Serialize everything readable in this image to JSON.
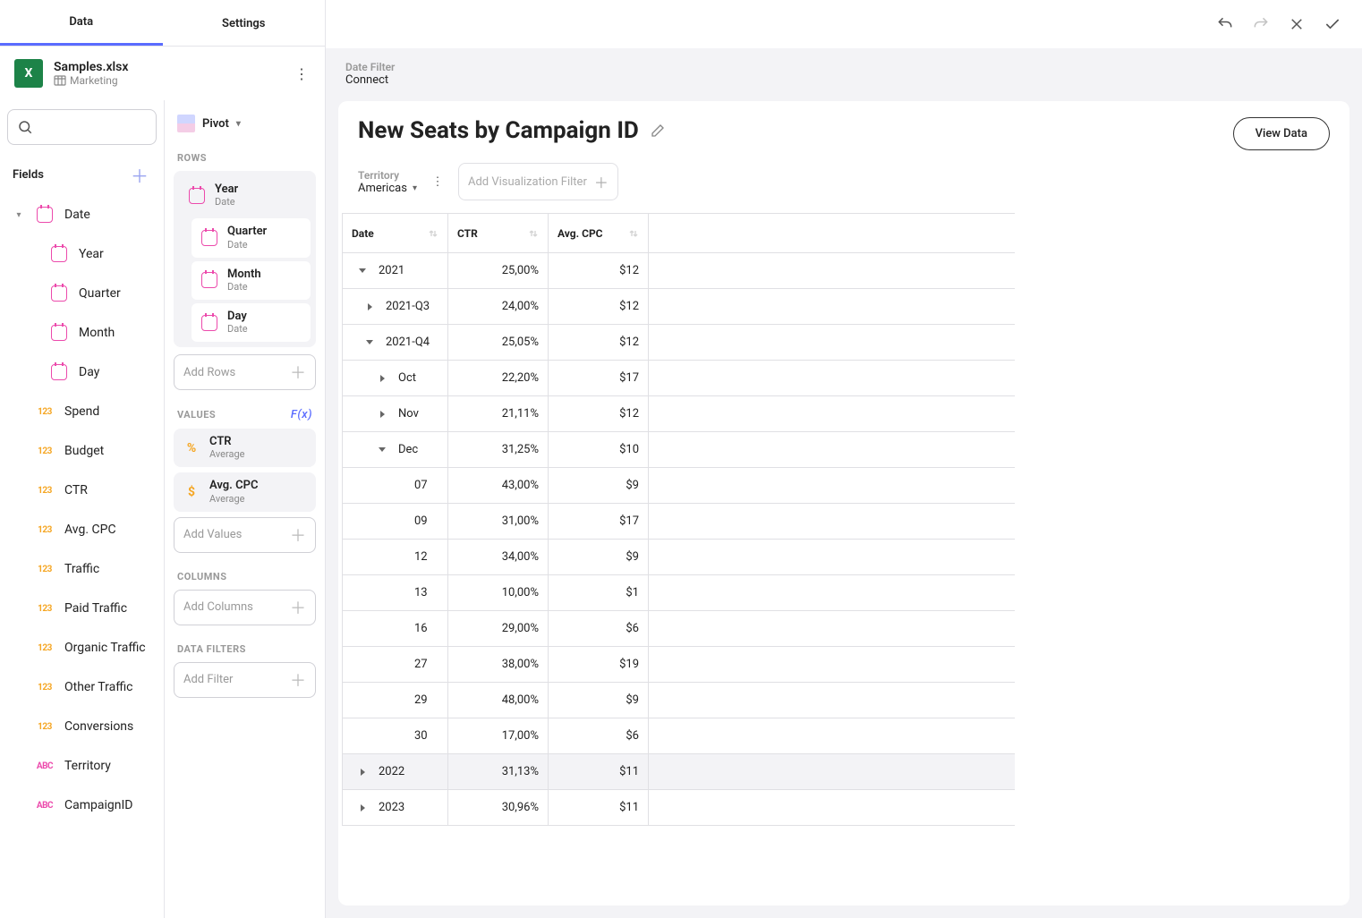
{
  "tabs": {
    "data": "Data",
    "settings": "Settings"
  },
  "file": {
    "name": "Samples.xlsx",
    "sheet": "Marketing"
  },
  "fields": {
    "label": "Fields",
    "items": [
      {
        "name": "Date",
        "type": "date",
        "expanded": true,
        "children": [
          {
            "name": "Year",
            "type": "date"
          },
          {
            "name": "Quarter",
            "type": "date"
          },
          {
            "name": "Month",
            "type": "date"
          },
          {
            "name": "Day",
            "type": "date"
          }
        ]
      },
      {
        "name": "Spend",
        "type": "num"
      },
      {
        "name": "Budget",
        "type": "num"
      },
      {
        "name": "CTR",
        "type": "num"
      },
      {
        "name": "Avg. CPC",
        "type": "num"
      },
      {
        "name": "Traffic",
        "type": "num"
      },
      {
        "name": "Paid Traffic",
        "type": "num"
      },
      {
        "name": "Organic Traffic",
        "type": "num"
      },
      {
        "name": "Other Traffic",
        "type": "num"
      },
      {
        "name": "Conversions",
        "type": "num"
      },
      {
        "name": "Territory",
        "type": "abc"
      },
      {
        "name": "CampaignID",
        "type": "abc"
      }
    ]
  },
  "viz_type": "Pivot",
  "config": {
    "rows_label": "ROWS",
    "values_label": "VALUES",
    "columns_label": "COLUMNS",
    "filters_label": "DATA FILTERS",
    "add_rows": "Add Rows",
    "add_values": "Add Values",
    "add_columns": "Add Columns",
    "add_filter": "Add Filter",
    "fx": "F(x)",
    "rows": [
      {
        "name": "Year",
        "sub": "Date"
      },
      {
        "name": "Quarter",
        "sub": "Date"
      },
      {
        "name": "Month",
        "sub": "Date"
      },
      {
        "name": "Day",
        "sub": "Date"
      }
    ],
    "values": [
      {
        "name": "CTR",
        "sub": "Average",
        "icon": "pct"
      },
      {
        "name": "Avg. CPC",
        "sub": "Average",
        "icon": "dollar"
      }
    ]
  },
  "filter_bar": {
    "label": "Date Filter",
    "value": "Connect"
  },
  "viz": {
    "title": "New Seats by Campaign ID",
    "view_data_btn": "View Data",
    "territory_label": "Territory",
    "territory_value": "Americas",
    "add_filter": "Add Visualization Filter"
  },
  "table": {
    "headers": [
      "Date",
      "CTR",
      "Avg. CPC"
    ],
    "rows": [
      {
        "indent": 0,
        "exp": "down",
        "label": "2021",
        "ctr": "25,00%",
        "cpc": "$12"
      },
      {
        "indent": 1,
        "exp": "right",
        "label": "2021-Q3",
        "ctr": "24,00%",
        "cpc": "$12"
      },
      {
        "indent": 1,
        "exp": "down",
        "label": "2021-Q4",
        "ctr": "25,05%",
        "cpc": "$12"
      },
      {
        "indent": 2,
        "exp": "right",
        "label": "Oct",
        "ctr": "22,20%",
        "cpc": "$17"
      },
      {
        "indent": 2,
        "exp": "right",
        "label": "Nov",
        "ctr": "21,11%",
        "cpc": "$12"
      },
      {
        "indent": 2,
        "exp": "down",
        "label": "Dec",
        "ctr": "31,25%",
        "cpc": "$10"
      },
      {
        "indent": 3,
        "exp": "",
        "label": "07",
        "ctr": "43,00%",
        "cpc": "$9"
      },
      {
        "indent": 3,
        "exp": "",
        "label": "09",
        "ctr": "31,00%",
        "cpc": "$17"
      },
      {
        "indent": 3,
        "exp": "",
        "label": "12",
        "ctr": "34,00%",
        "cpc": "$9"
      },
      {
        "indent": 3,
        "exp": "",
        "label": "13",
        "ctr": "10,00%",
        "cpc": "$1"
      },
      {
        "indent": 3,
        "exp": "",
        "label": "16",
        "ctr": "29,00%",
        "cpc": "$6"
      },
      {
        "indent": 3,
        "exp": "",
        "label": "27",
        "ctr": "38,00%",
        "cpc": "$19"
      },
      {
        "indent": 3,
        "exp": "",
        "label": "29",
        "ctr": "48,00%",
        "cpc": "$9"
      },
      {
        "indent": 3,
        "exp": "",
        "label": "30",
        "ctr": "17,00%",
        "cpc": "$6"
      },
      {
        "indent": 0,
        "exp": "right",
        "label": "2022",
        "ctr": "31,13%",
        "cpc": "$11",
        "highlight": true
      },
      {
        "indent": 0,
        "exp": "right",
        "label": "2023",
        "ctr": "30,96%",
        "cpc": "$11"
      }
    ]
  }
}
